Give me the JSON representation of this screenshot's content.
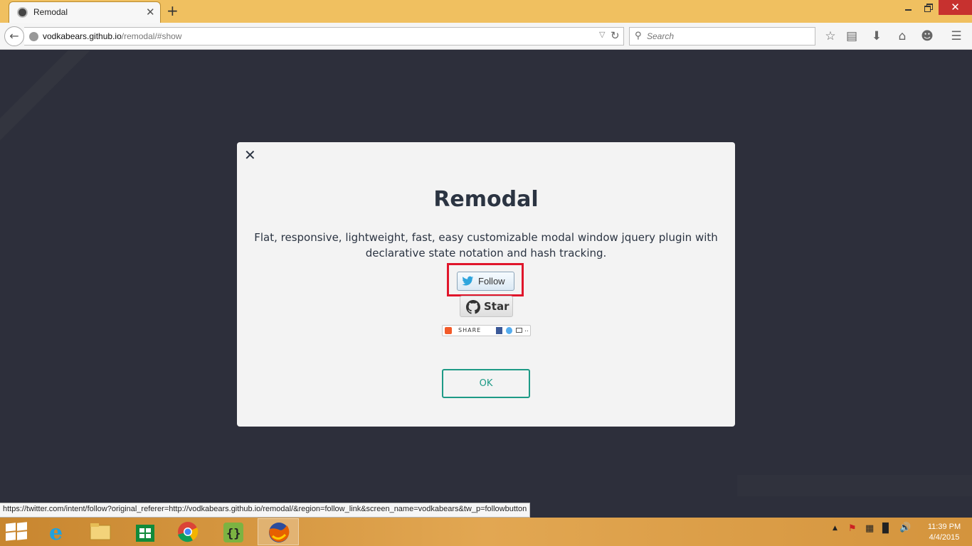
{
  "browser": {
    "tab": {
      "title": "Remodal",
      "close_glyph": "✕"
    },
    "new_tab_glyph": "+",
    "window_controls": {
      "close_glyph": "✕"
    },
    "url": {
      "host": "vodkabears.github.io",
      "path": "/remodal/#show"
    },
    "search": {
      "placeholder": "Search"
    },
    "toolbar_icons": [
      "star-icon",
      "reading-list-icon",
      "download-icon",
      "home-icon",
      "smiley-icon",
      "menu-icon"
    ]
  },
  "modal": {
    "close_glyph": "✕",
    "title": "Remodal",
    "description": "Flat, responsive, lightweight, fast, easy customizable modal window jquery plugin with declarative state notation and hash tracking.",
    "follow_label": "Follow",
    "star_label": "Star",
    "share_label": "SHARE",
    "share_more": "..",
    "ok_label": "OK"
  },
  "status_url": "https://twitter.com/intent/follow?original_referer=http://vodkabears.github.io/remodal/&region=follow_link&screen_name=vodkabears&tw_p=followbutton",
  "taskbar": {
    "apps": [
      "internet-explorer",
      "file-explorer",
      "store",
      "chrome",
      "brackets",
      "firefox"
    ],
    "clock": {
      "time": "11:39 PM",
      "date": "4/4/2015"
    }
  },
  "colors": {
    "accent": "#1d9a86",
    "highlight": "#e0162b",
    "page_bg": "#2d2f3b",
    "titlebar": "#f0c060"
  }
}
